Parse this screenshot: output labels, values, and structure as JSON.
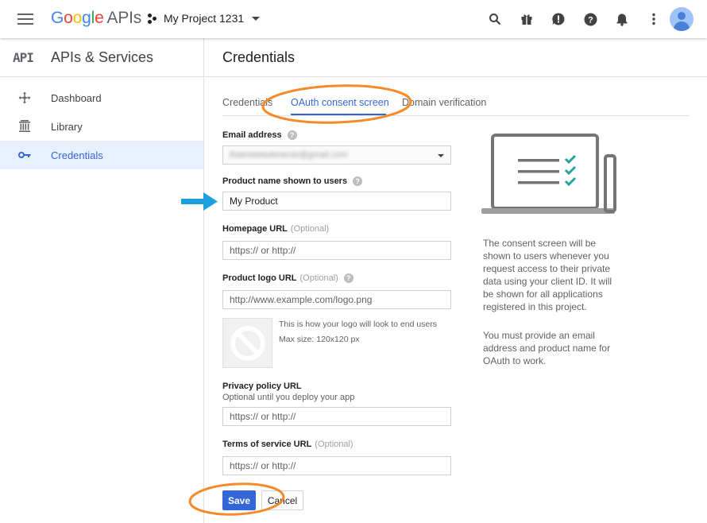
{
  "topbar": {
    "brand_letters": [
      "G",
      "o",
      "o",
      "g",
      "l",
      "e"
    ],
    "brand_suffix": "APIs",
    "project_name": "My Project 1231",
    "icons": [
      "search-icon",
      "gift-icon",
      "alert-icon",
      "help-icon",
      "bell-icon",
      "more-vert-icon"
    ]
  },
  "sidebar": {
    "badge": "API",
    "title": "APIs & Services",
    "items": [
      {
        "label": "Dashboard",
        "icon": "dashboard-icon",
        "active": false
      },
      {
        "label": "Library",
        "icon": "library-icon",
        "active": false
      },
      {
        "label": "Credentials",
        "icon": "key-icon",
        "active": true
      }
    ]
  },
  "main": {
    "title": "Credentials",
    "tabs": [
      {
        "label": "Credentials",
        "active": false
      },
      {
        "label": "OAuth consent screen",
        "active": true
      },
      {
        "label": "Domain verification",
        "active": false
      }
    ]
  },
  "form": {
    "email_label": "Email address",
    "email_value_obscured": "thatmeetsdonecto@gmail.com",
    "product_label": "Product name shown to users",
    "product_value": "My Product",
    "homepage_label": "Homepage URL",
    "optional": "(Optional)",
    "homepage_placeholder": "https:// or http://",
    "logo_label": "Product logo URL",
    "logo_placeholder": "http://www.example.com/logo.png",
    "logo_hint_1": "This is how your logo will look to end users",
    "logo_hint_2": "Max size: 120x120 px",
    "privacy_label": "Privacy policy URL",
    "privacy_sub": "Optional until you deploy your app",
    "privacy_placeholder": "https:// or http://",
    "terms_label": "Terms of service URL",
    "terms_placeholder": "https:// or http://",
    "save_label": "Save",
    "cancel_label": "Cancel"
  },
  "info": {
    "paragraph_1": "The consent screen will be shown to users whenever you request access to their private data using your client ID. It will be shown for all applications registered in this project.",
    "paragraph_2": "You must provide an email address and product name for OAuth to work."
  },
  "colors": {
    "accent": "#3367d6",
    "annotation_orange": "#f58a2b",
    "annotation_arrow": "#1ea0e0",
    "check_teal": "#26a69a"
  }
}
